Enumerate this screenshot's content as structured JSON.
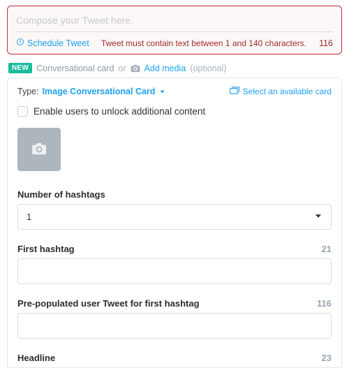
{
  "compose": {
    "placeholder": "Compose your Tweet here.",
    "schedule_label": "Schedule Tweet",
    "error": "Tweet must contain text between 1 and 140 characters.",
    "char_count": "116"
  },
  "media_row": {
    "badge": "NEW",
    "converse_label": "Conversational card",
    "or": "or",
    "add_media": "Add media",
    "optional": "(optional)"
  },
  "card": {
    "type_label": "Type:",
    "type_value": "Image Conversational Card",
    "select_label": "Select an available card",
    "enable_label": "Enable users to unlock additional content"
  },
  "fields": {
    "number_of_hashtags": {
      "label": "Number of hashtags",
      "value": "1"
    },
    "first_hashtag": {
      "label": "First hashtag",
      "counter": "21",
      "value": ""
    },
    "prepop": {
      "label": "Pre-populated user Tweet for first hashtag",
      "counter": "116",
      "value": ""
    },
    "headline": {
      "label": "Headline",
      "counter": "23"
    }
  }
}
